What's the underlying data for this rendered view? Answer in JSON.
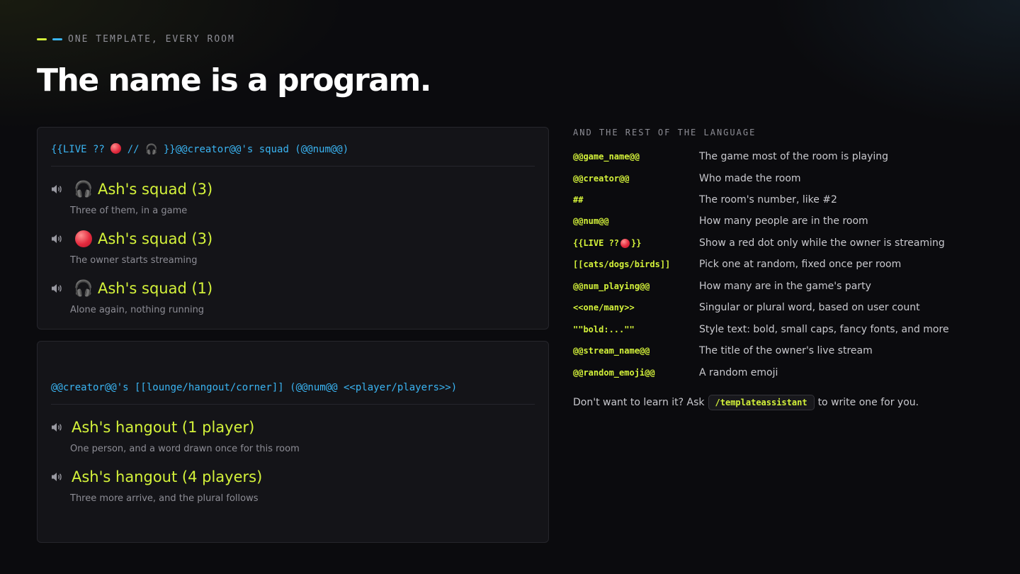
{
  "eyebrow": "ONE TEMPLATE, EVERY ROOM",
  "headline": "The name is a program.",
  "colors": {
    "accent_lime": "#d4f23a",
    "accent_cyan": "#3ab4f2",
    "live_red": "#e32a3e"
  },
  "card1": {
    "template_parts": [
      "{{LIVE ?? ",
      " // 🎧 }}@@creator@@'s squad (@@num@@)"
    ],
    "examples": [
      {
        "icon": "headphones-icon",
        "glyph": "🎧",
        "name": "Ash's squad (3)",
        "desc": "Three of them, in a game"
      },
      {
        "icon": "red-circle-icon",
        "glyph": "",
        "name": "Ash's squad (3)",
        "desc": "The owner starts streaming"
      },
      {
        "icon": "headphones-icon",
        "glyph": "🎧",
        "name": "Ash's squad (1)",
        "desc": "Alone again, nothing running"
      }
    ]
  },
  "card2": {
    "template": "@@creator@@'s [[lounge/hangout/corner]] (@@num@@ <<player/players>>)",
    "examples": [
      {
        "name": "Ash's hangout (1 player)",
        "desc": "One person, and a word drawn once for this room"
      },
      {
        "name": "Ash's hangout (4 players)",
        "desc": "Three more arrive, and the plural follows"
      }
    ]
  },
  "reference": {
    "title": "AND THE REST OF THE LANGUAGE",
    "rows": [
      {
        "key": "@@game_name@@",
        "desc": "The game most of the room is playing"
      },
      {
        "key": "@@creator@@",
        "desc": "Who made the room"
      },
      {
        "key": "##",
        "desc": "The room's number, like #2"
      },
      {
        "key": "@@num@@",
        "desc": "How many people are in the room"
      },
      {
        "key_parts": [
          "{{LIVE ?? ",
          "}}"
        ],
        "desc": "Show a red dot only while the owner is streaming"
      },
      {
        "key": "[[cats/dogs/birds]]",
        "desc": "Pick one at random, fixed once per room"
      },
      {
        "key": "@@num_playing@@",
        "desc": "How many are in the game's party"
      },
      {
        "key": "<<one/many>>",
        "desc": "Singular or plural word, based on user count"
      },
      {
        "key": "\"\"bold:...\"\"",
        "desc": "Style text: bold, small caps, fancy fonts, and more"
      },
      {
        "key": "@@stream_name@@",
        "desc": "The title of the owner's live stream"
      },
      {
        "key": "@@random_emoji@@",
        "desc": "A random emoji"
      }
    ],
    "footer_before": "Don't want to learn it? Ask",
    "footer_command": "/templateassistant",
    "footer_after": "to write one for you."
  }
}
